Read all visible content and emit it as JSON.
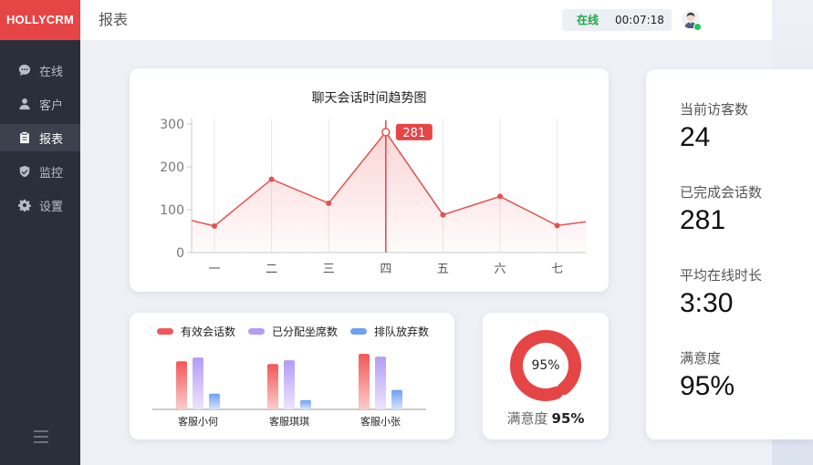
{
  "app": {
    "logo": "HOLLYCRM"
  },
  "sidebar": {
    "items": [
      {
        "label": "在线",
        "icon": "chat-icon",
        "active": false
      },
      {
        "label": "客户",
        "icon": "user-icon",
        "active": false
      },
      {
        "label": "报表",
        "icon": "clipboard-icon",
        "active": true
      },
      {
        "label": "监控",
        "icon": "shield-icon",
        "active": false
      },
      {
        "label": "设置",
        "icon": "gear-icon",
        "active": false
      }
    ],
    "menu_icon": "hamburger-icon"
  },
  "header": {
    "title": "报表",
    "status": "在线",
    "timer": "00:07:18",
    "status_color": "#1ea84a"
  },
  "colors": {
    "accent": "#e64545",
    "series_valid": "#f25757",
    "series_assigned": "#b49cf5",
    "series_abandoned": "#6fa0f2"
  },
  "chart_data": [
    {
      "type": "line",
      "title": "聊天会话时间趋势图",
      "categories": [
        "一",
        "二",
        "三",
        "四",
        "五",
        "六",
        "七"
      ],
      "values": [
        62,
        171,
        115,
        281,
        88,
        131,
        63
      ],
      "edge_values": {
        "start": 75,
        "end": 72
      },
      "highlight": {
        "index": 3,
        "label": "281"
      },
      "ylim": [
        0,
        300
      ],
      "yticks": [
        0,
        100,
        200,
        300
      ],
      "xlabel": "",
      "ylabel": ""
    },
    {
      "type": "bar",
      "categories": [
        "客服小何",
        "客服琪琪",
        "客服小张"
      ],
      "series": [
        {
          "name": "有效会话数",
          "values": [
            52,
            49,
            60
          ],
          "color": "#f25757"
        },
        {
          "name": "已分配坐席数",
          "values": [
            56,
            53,
            57
          ],
          "color": "#b49cf5"
        },
        {
          "name": "排队放弃数",
          "values": [
            17,
            10,
            21
          ],
          "color": "#6fa0f2"
        }
      ],
      "ylim": [
        0,
        65
      ],
      "legend": "top"
    },
    {
      "type": "pie",
      "title": "满意度",
      "values": [
        95,
        5
      ],
      "center_label": "95%",
      "label_value": "95%",
      "color": "#e64545"
    }
  ],
  "stats": [
    {
      "label": "当前访客数",
      "value": "24"
    },
    {
      "label": "已完成会话数",
      "value": "281"
    },
    {
      "label": "平均在线时长",
      "value": "3:30"
    },
    {
      "label": "满意度",
      "value": "95%"
    }
  ]
}
